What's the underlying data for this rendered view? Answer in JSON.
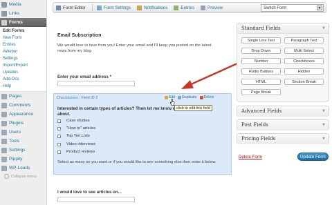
{
  "sidebar": {
    "items_top": [
      {
        "label": "Media",
        "icon": "media-icon",
        "color": "#7a8c99"
      },
      {
        "label": "Links",
        "icon": "links-icon",
        "color": "#7a8c99"
      }
    ],
    "current": {
      "label": "Forms",
      "icon": "forms-icon"
    },
    "submenu": [
      "Edit Forms",
      "New Form",
      "Entries",
      "AWeber",
      "Settings",
      "Import/Export",
      "Updates",
      "Add-Ons",
      "Help"
    ],
    "items_bottom": [
      {
        "label": "Pages",
        "icon": "pages-icon",
        "color": "#8899a6"
      },
      {
        "label": "Comments",
        "icon": "comments-icon",
        "color": "#8899a6"
      },
      {
        "label": "Appearance",
        "icon": "appearance-icon",
        "color": "#8899a6"
      },
      {
        "label": "Plugins",
        "icon": "plugins-icon",
        "color": "#8899a6"
      },
      {
        "label": "Users",
        "icon": "users-icon",
        "color": "#8899a6"
      },
      {
        "label": "Tools",
        "icon": "tools-icon",
        "color": "#8899a6"
      },
      {
        "label": "Settings",
        "icon": "settings-icon",
        "color": "#8899a6"
      },
      {
        "label": "Pippity",
        "icon": "pippity-icon",
        "color": "#8899a6"
      },
      {
        "label": "WP-Leads",
        "icon": "wp-leads-icon",
        "color": "#8899a6"
      }
    ],
    "collapse_label": "Collapse menu"
  },
  "toolbar": {
    "items": [
      {
        "label": "Form Editor",
        "icon": "form-editor-icon"
      },
      {
        "label": "Form Settings",
        "icon": "form-settings-icon"
      },
      {
        "label": "Notifications",
        "icon": "notifications-icon"
      },
      {
        "label": "Entries",
        "icon": "entries-icon"
      },
      {
        "label": "Preview",
        "icon": "preview-icon"
      }
    ],
    "switch_form": "Switch Form"
  },
  "form": {
    "title": "Email Subscription",
    "description": "We would love to hear from you! Enter your email and I'll keep you posted on the latest news from my blog.",
    "email_label": "Enter your email address *",
    "checkbox_field": {
      "header": "Checkboxes : Field ID 2",
      "actions": {
        "edit": "Edit",
        "duplicate": "Duplicate",
        "delete": "Delete"
      },
      "question": "Interested in certain types of articles? Then let me know what about.",
      "options": [
        "Case studies",
        "\"How to\" articles",
        "Top Ten Lists",
        "Video interviews",
        "Product reviews"
      ],
      "hint": "Select as many as you want or if you would like to see something else then enter it below."
    },
    "tooltip": "click to edit this field",
    "articles_label": "I would love to see articles on..."
  },
  "panels": {
    "standard": {
      "title": "Standard Fields",
      "buttons": [
        "Single Line Text",
        "Paragraph Text",
        "Drop Down",
        "Multi Select",
        "Number",
        "Checkboxes",
        "Radio Buttons",
        "Hidden",
        "HTML",
        "Section Break",
        "Page Break"
      ]
    },
    "advanced": "Advanced Fields",
    "post": "Post Fields",
    "pricing": "Pricing Fields"
  },
  "actions": {
    "delete_form": "Delete Form",
    "update_form": "Update Form"
  },
  "colors": {
    "link": "#21759b",
    "field_highlight": "#dce9f8",
    "annotation_arrow": "#c0392b",
    "delete": "#bc0b0b",
    "update_button": "#2a7db5"
  }
}
